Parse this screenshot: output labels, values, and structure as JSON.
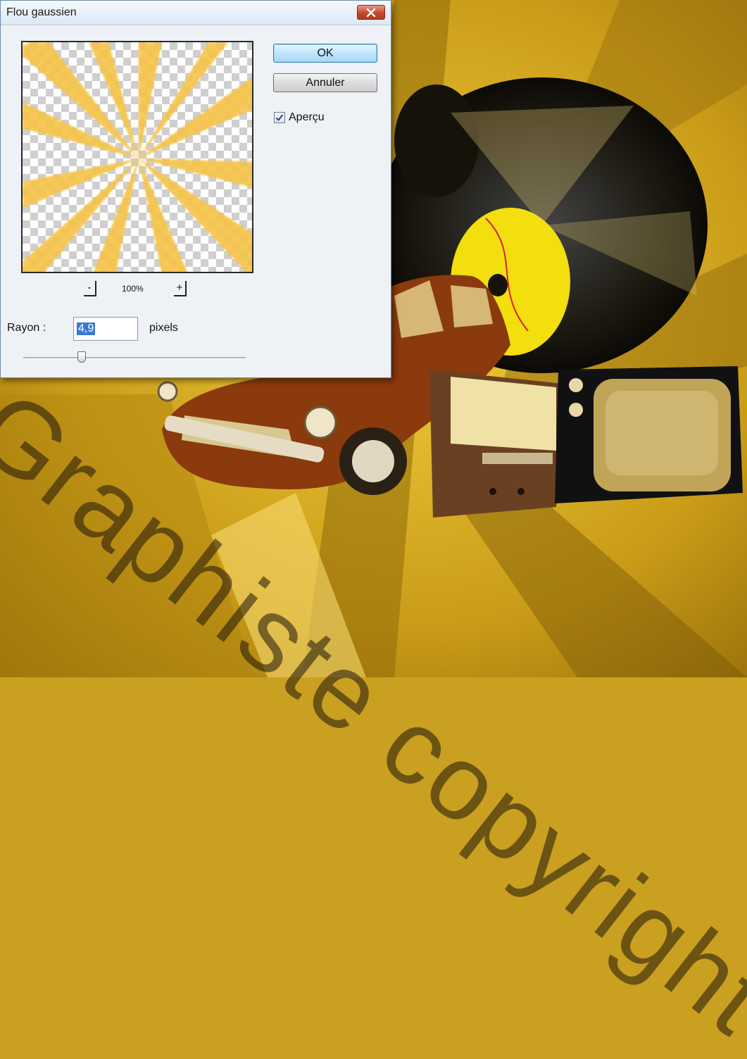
{
  "dialog": {
    "title": "Flou gaussien",
    "ok_label": "OK",
    "cancel_label": "Annuler",
    "preview_checkbox_label": "Aperçu",
    "preview_checked": true,
    "zoom_minus": "-",
    "zoom_plus": "+",
    "zoom_level": "100%",
    "radius_label": "Rayon :",
    "radius_value": "4,9",
    "radius_unit": "pixels",
    "radius_slider_fraction": 0.3
  },
  "watermark": {
    "text": "Graphiste copyright"
  },
  "colors": {
    "accent_selection": "#3a78d4",
    "ok_button": "#bee6fd",
    "close_button": "#c4492f",
    "background_gold": "#c9a020"
  },
  "icons": {
    "close": "close-icon",
    "checkmark": "check-icon"
  }
}
